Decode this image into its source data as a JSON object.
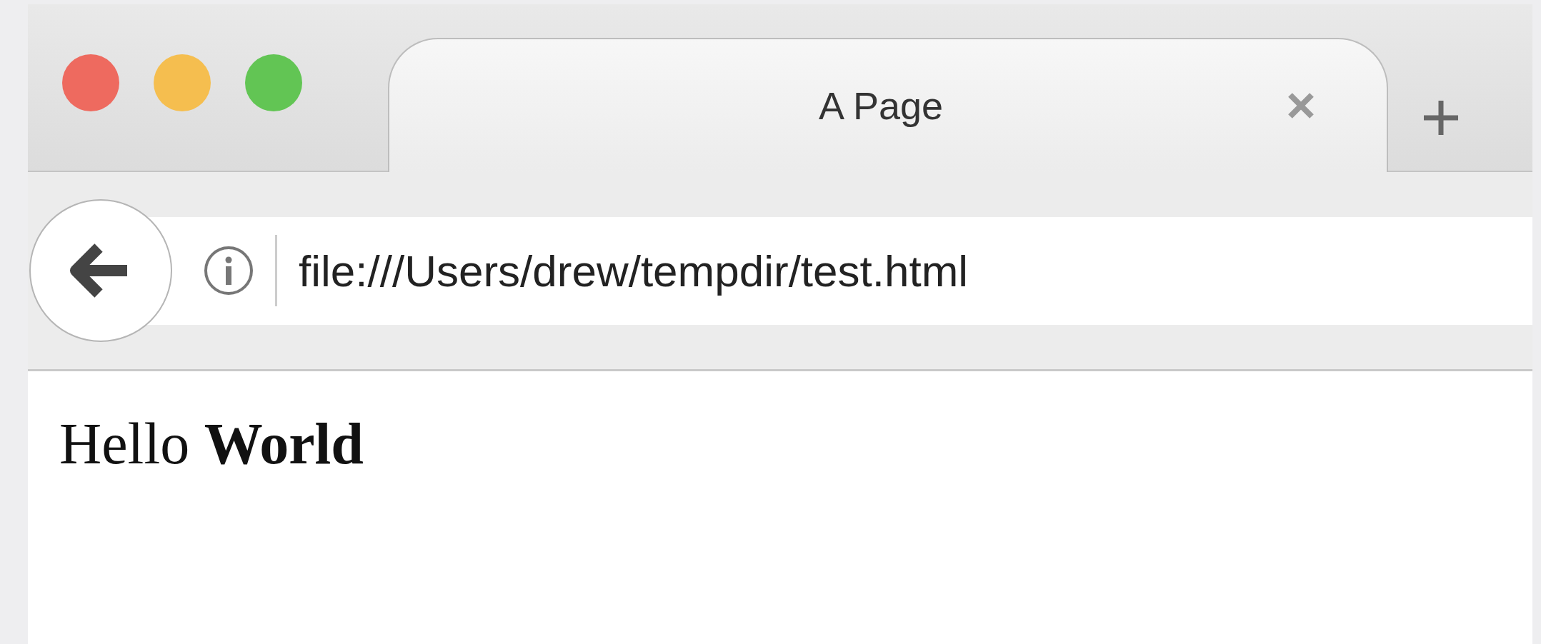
{
  "window": {
    "controls": [
      {
        "color": "#ee6a5f"
      },
      {
        "color": "#f5be4f"
      },
      {
        "color": "#62c554"
      }
    ]
  },
  "tabs": [
    {
      "title": "A Page",
      "selected": true
    }
  ],
  "toolbar": {
    "url": "file:///Users/drew/tempdir/test.html"
  },
  "page": {
    "text": "Hello **World**"
  }
}
